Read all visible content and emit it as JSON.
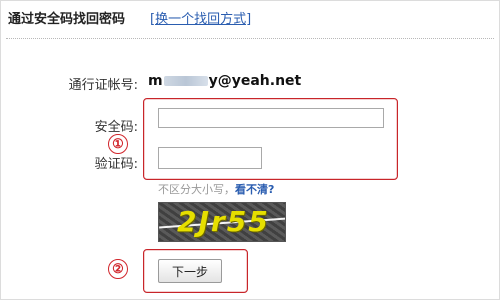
{
  "header": {
    "title": "通过安全码找回密码",
    "switch_link": "[换一个找回方式]"
  },
  "form": {
    "account_label": "通行证帐号:",
    "account_prefix": "m",
    "account_suffix": "y@yeah.net",
    "security_code_label": "安全码:",
    "security_code_value": "",
    "captcha_label": "验证码:",
    "captcha_value": "",
    "hint_text": "不区分大小写，",
    "hint_link": "看不清?",
    "captcha_image_text": "2Jr55",
    "next_button": "下一步"
  },
  "annotations": {
    "marker_1": "①",
    "marker_2": "②"
  },
  "colors": {
    "link": "#2a5db0",
    "annotation_red": "#c8252a",
    "captcha_text": "#e6df00"
  },
  "icons": []
}
